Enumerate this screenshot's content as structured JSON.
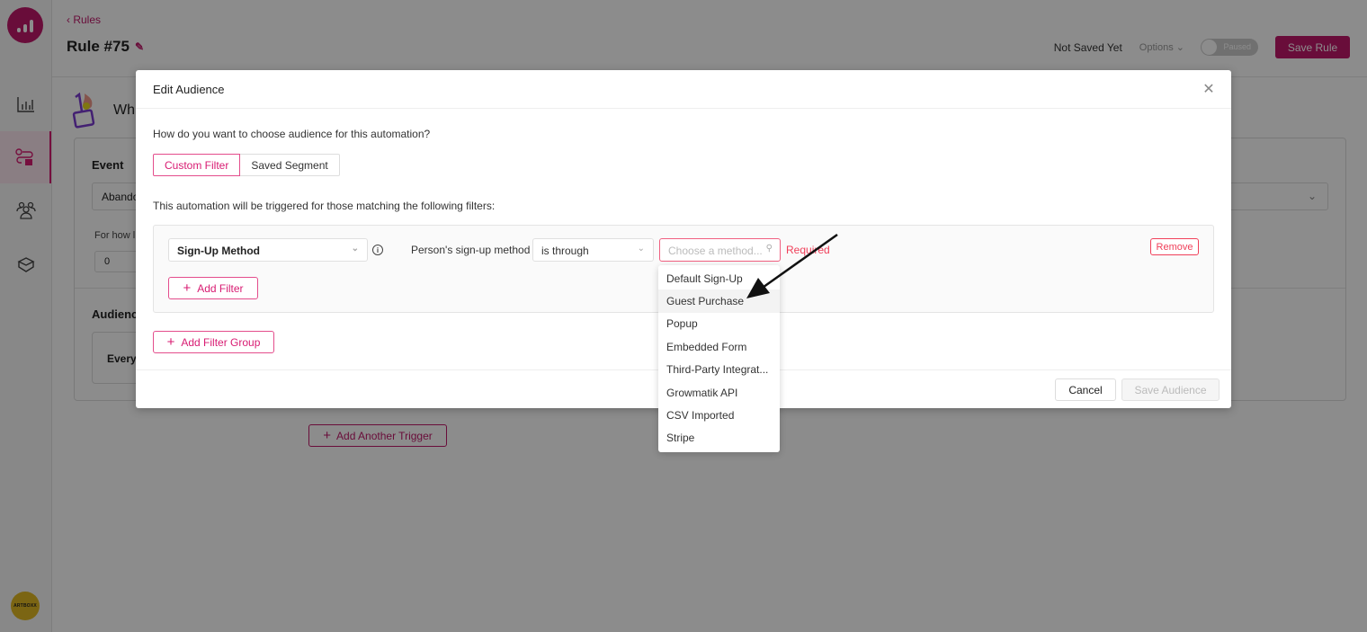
{
  "sidebar": {
    "logo": "analytics-logo",
    "items": [
      {
        "name": "analytics",
        "icon": "bar-chart-icon",
        "active": false
      },
      {
        "name": "automations",
        "icon": "workflow-icon",
        "active": true
      },
      {
        "name": "audience",
        "icon": "people-icon",
        "active": false
      },
      {
        "name": "integrations",
        "icon": "cube-icon",
        "active": false
      }
    ],
    "org_avatar_label": "ARTBOXX"
  },
  "header": {
    "back_label": "Rules",
    "title": "Rule #75",
    "save_status": "Not Saved Yet",
    "options_label": "Options",
    "toggle_label": "Paused",
    "toggle_on": false,
    "save_button": "Save Rule"
  },
  "background": {
    "trigger_title": "Wh",
    "event_label": "Event",
    "event_value": "Abando",
    "for_how_label": "For how l",
    "for_how_value": "0",
    "audience_label": "Audienc",
    "audience_value": "Everyo",
    "add_trigger_button": "Add Another Trigger"
  },
  "modal": {
    "title": "Edit Audience",
    "question": "How do you want to choose audience for this automation?",
    "mode_options": [
      {
        "label": "Custom Filter",
        "active": true
      },
      {
        "label": "Saved Segment",
        "active": false
      }
    ],
    "trigger_note": "This automation will be triggered for those matching the following filters:",
    "filter": {
      "field": "Sign-Up Method",
      "condition_label": "Person's sign-up method",
      "operator": "is through",
      "value_placeholder": "Choose a method...",
      "validation": "Required",
      "remove_button": "Remove"
    },
    "add_filter_button": "Add Filter",
    "add_filter_group_button": "Add Filter Group",
    "cancel_button": "Cancel",
    "save_button": "Save Audience"
  },
  "dropdown": {
    "options": [
      "Default Sign-Up",
      "Guest Purchase",
      "Popup",
      "Embedded Form",
      "Third-Party Integrat...",
      "Growmatik API",
      "CSV Imported",
      "Stripe"
    ],
    "hovered_index": 1
  },
  "colors": {
    "brand": "#c0186a",
    "accent_pink": "#d81b72",
    "error": "#f0405a"
  }
}
